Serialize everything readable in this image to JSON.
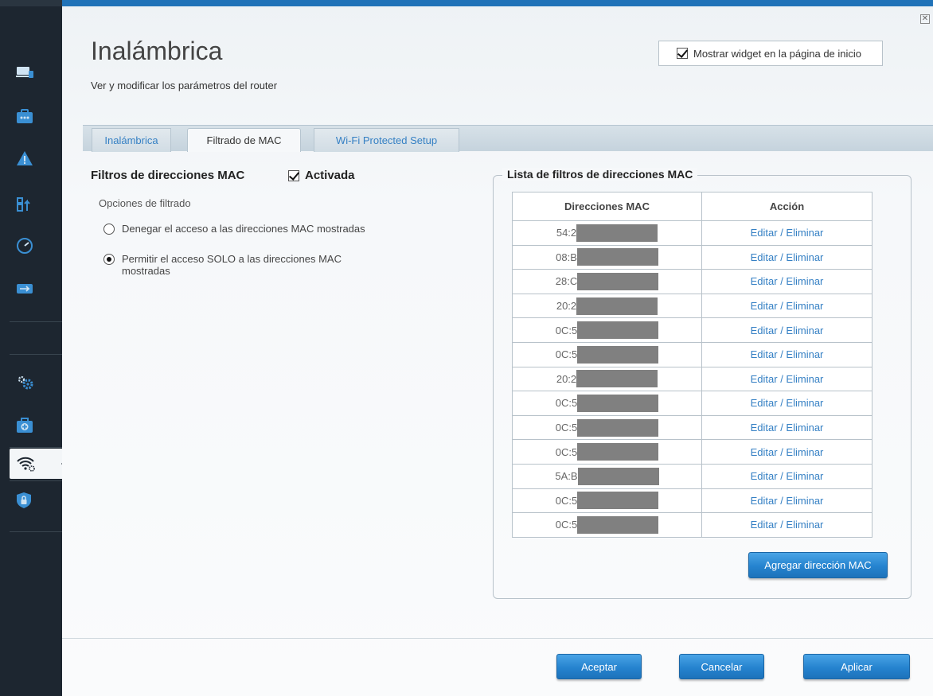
{
  "page": {
    "title": "Inalámbrica",
    "subtitle": "Ver y modificar los parámetros del router",
    "show_widget_label": "Mostrar widget en la página de inicio",
    "show_widget_checked": true,
    "close_label": "✕"
  },
  "tabs": [
    {
      "label": "Inalámbrica",
      "active": false
    },
    {
      "label": "Filtrado de MAC",
      "active": true
    },
    {
      "label": "Wi-Fi Protected Setup",
      "active": false
    }
  ],
  "filters": {
    "title": "Filtros de direcciones MAC",
    "enabled_label": "Activada",
    "enabled": true,
    "options_title": "Opciones de filtrado",
    "option_deny": "Denegar el acceso a las direcciones MAC mostradas",
    "option_allow": "Permitir el acceso SOLO a las direcciones MAC mostradas",
    "selected": "allow"
  },
  "mac_list": {
    "legend": "Lista de filtros de direcciones MAC",
    "col_mac": "Direcciones MAC",
    "col_action": "Acción",
    "action_label": "Editar / Eliminar",
    "rows": [
      {
        "mac": "54:2"
      },
      {
        "mac": "08:B"
      },
      {
        "mac": "28:C"
      },
      {
        "mac": "20:2"
      },
      {
        "mac": "0C:5"
      },
      {
        "mac": "0C:5"
      },
      {
        "mac": "20:2"
      },
      {
        "mac": "0C:5"
      },
      {
        "mac": "0C:5"
      },
      {
        "mac": "0C:5"
      },
      {
        "mac": "5A:B"
      },
      {
        "mac": "0C:5"
      },
      {
        "mac": "0C:5"
      }
    ],
    "add_button": "Agregar dirección MAC"
  },
  "footer": {
    "accept": "Aceptar",
    "cancel": "Cancelar",
    "apply": "Aplicar"
  },
  "colors": {
    "accent": "#1f72b8",
    "sidebar": "#1d2630",
    "link": "#3580c4"
  }
}
